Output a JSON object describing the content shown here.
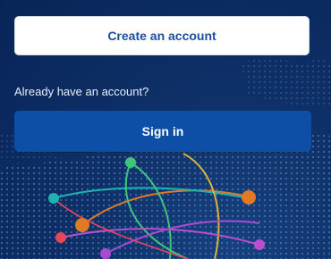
{
  "actions": {
    "create_account_label": "Create an account",
    "already_text": "Already have an account?",
    "sign_in_label": "Sign in"
  },
  "colors": {
    "background": "#0a2a5a",
    "primary_button": "#0d4ea6",
    "secondary_button_text": "#1d4e9e"
  },
  "illustration": {
    "icon": "network-map-illustration"
  }
}
